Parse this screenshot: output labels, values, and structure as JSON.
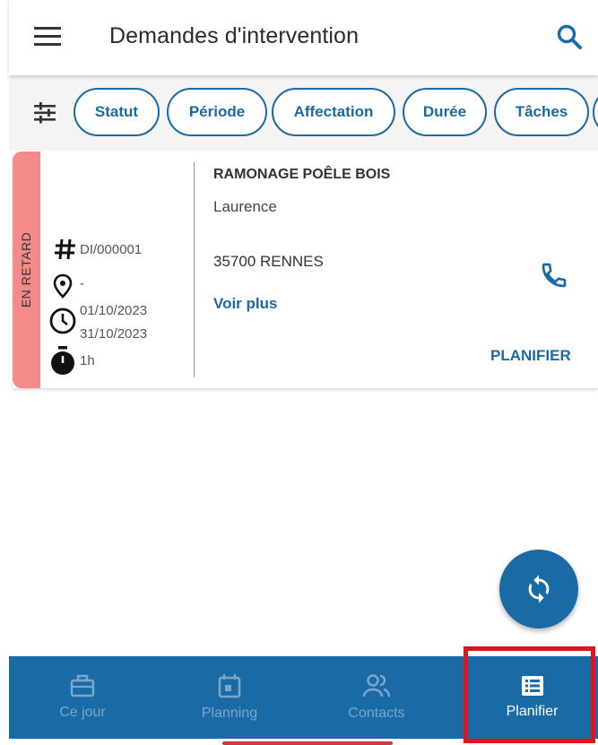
{
  "header": {
    "title": "Demandes d'intervention",
    "menu_icon": "menu-icon",
    "search_icon": "search-icon"
  },
  "filters": [
    "Statut",
    "Période",
    "Affectation",
    "Durée",
    "Tâches"
  ],
  "card": {
    "status": "EN RETARD",
    "reference": "DI/000001",
    "location": "-",
    "start_date": "01/10/2023",
    "end_date": "31/10/2023",
    "duration": "1h",
    "title": "RAMONAGE POÊLE BOIS",
    "client": "Laurence",
    "city": "35700 RENNES",
    "more_label": "Voir plus",
    "action_label": "PLANIFIER"
  },
  "colors": {
    "primary": "#1a6aa5",
    "late": "#f48a8a",
    "highlight": "#e0141e"
  },
  "bottom_nav": [
    {
      "label": "Ce jour",
      "icon": "briefcase-icon",
      "active": false
    },
    {
      "label": "Planning",
      "icon": "calendar-icon",
      "active": false
    },
    {
      "label": "Contacts",
      "icon": "contacts-icon",
      "active": false
    },
    {
      "label": "Planifier",
      "icon": "list-icon",
      "active": true
    }
  ]
}
